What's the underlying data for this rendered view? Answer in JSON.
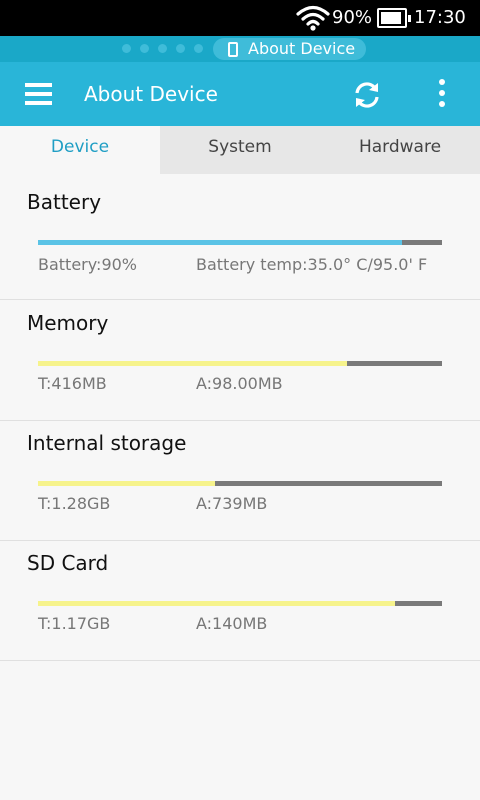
{
  "status_bar": {
    "wifi_icon": "wifi-icon",
    "battery_percent": "90%",
    "battery_level": 0.9,
    "time": "17:30"
  },
  "notification_strip": {
    "page_dots": 5,
    "active_label": "About Device",
    "icon": "phone-icon"
  },
  "app_bar": {
    "title": "About Device",
    "menu_icon": "hamburger-menu-icon",
    "refresh_icon": "refresh-icon",
    "more_icon": "more-vertical-icon"
  },
  "tabs": [
    {
      "label": "Device",
      "active": true
    },
    {
      "label": "System",
      "active": false
    },
    {
      "label": "Hardware",
      "active": false
    }
  ],
  "sections": [
    {
      "title": "Battery",
      "fill": 0.9,
      "fill_color": "#5bc3e6",
      "label1": "Battery:90%",
      "label2": "Battery temp:35.0° C/95.0' F"
    },
    {
      "title": "Memory",
      "fill": 0.765,
      "fill_color": "#f6f38c",
      "label1": "T:416MB",
      "label2": "A:98.00MB"
    },
    {
      "title": "Internal storage",
      "fill": 0.437,
      "fill_color": "#f6f38c",
      "label1": "T:1.28GB",
      "label2": "A:739MB"
    },
    {
      "title": "SD Card",
      "fill": 0.883,
      "fill_color": "#f6f38c",
      "label1": "T:1.17GB",
      "label2": "A:140MB"
    }
  ],
  "colors": {
    "primary": "#29b5d8",
    "primary_dark": "#1aa8c8",
    "tab_active_text": "#1f9ec4",
    "bar_track": "#7a7a7a"
  }
}
